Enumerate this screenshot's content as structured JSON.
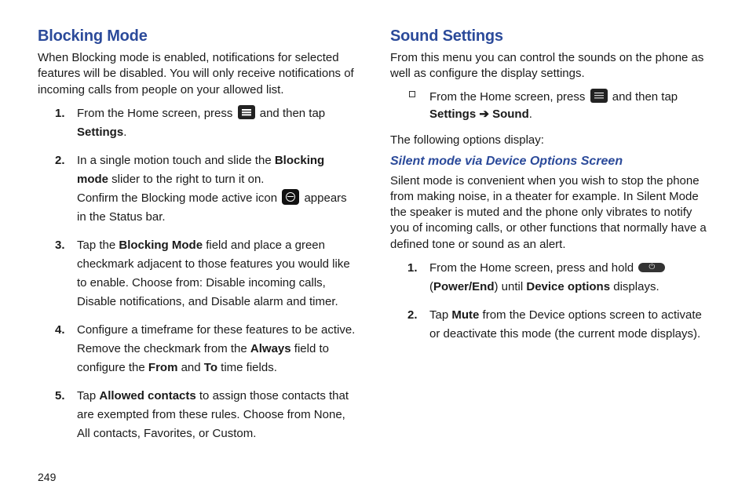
{
  "page_number": "249",
  "left": {
    "heading": "Blocking Mode",
    "intro": "When Blocking mode is enabled, notifications for selected features will be disabled. You will only receive notifications of incoming calls from people on your allowed list.",
    "steps": {
      "s1_a": "From the Home screen, press ",
      "s1_b": " and then tap ",
      "s1_settings": "Settings",
      "s1_c": ".",
      "s2_a": "In a single motion touch and slide the ",
      "s2_bold": "Blocking mode",
      "s2_b": " slider to the right to turn it on.",
      "s2_c": "Confirm the Blocking mode active icon ",
      "s2_d": " appears in the Status bar.",
      "s3_a": "Tap the ",
      "s3_bold": "Blocking Mode",
      "s3_b": " field and place a green checkmark adjacent to those features you would like to enable. Choose from: Disable incoming calls, Disable notifications, and Disable alarm and timer.",
      "s4_a": "Configure a timeframe for these features to be active. Remove the checkmark from the ",
      "s4_bold1": "Always",
      "s4_b": " field to configure the ",
      "s4_bold2": "From",
      "s4_c": " and ",
      "s4_bold3": "To",
      "s4_d": " time fields.",
      "s5_a": "Tap ",
      "s5_bold": "Allowed contacts",
      "s5_b": " to assign those contacts that are exempted from these rules. Choose from None, All contacts, Favorites, or Custom."
    }
  },
  "right": {
    "heading": "Sound Settings",
    "intro": "From this menu you can control the sounds on the phone as well as configure the display settings.",
    "bullet": {
      "a": "From the Home screen, press ",
      "b": " and then tap ",
      "bold1": "Settings",
      "arrow": " ➔ ",
      "bold2": "Sound",
      "c": "."
    },
    "after_options": "The following options display:",
    "subheading": "Silent mode via Device Options Screen",
    "silent_intro": "Silent mode is convenient when you wish to stop the phone from making noise, in a theater for example. In Silent Mode the speaker is muted and the phone only vibrates to notify you of incoming calls, or other functions that normally have a defined tone or sound as an alert.",
    "steps": {
      "s1_a": "From the Home screen, press and hold ",
      "s1_b": " (",
      "s1_bold": "Power/End",
      "s1_c": ") until ",
      "s1_bold2": "Device options",
      "s1_d": " displays.",
      "s2_a": "Tap ",
      "s2_bold": "Mute",
      "s2_b": " from the Device options screen to activate or deactivate this mode (the current mode displays)."
    }
  }
}
